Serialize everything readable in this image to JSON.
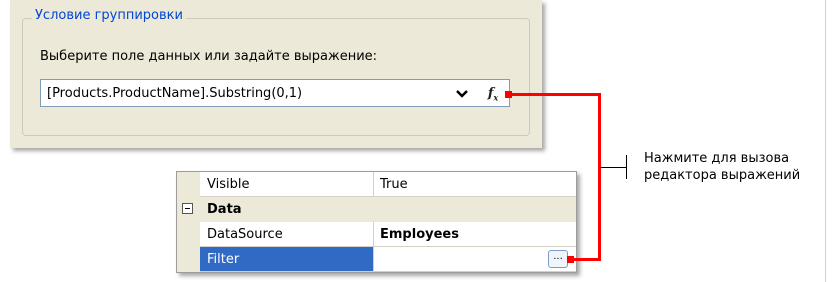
{
  "dialog": {
    "group_title": "Условие группировки",
    "prompt": "Выберите поле данных или задайте выражение:",
    "expression_value": "[Products.ProductName].Substring(0,1)",
    "dropdown_icon": "chevron-down-icon",
    "fx_button": {
      "label": "f",
      "sub": "x"
    }
  },
  "property_grid": {
    "rows": [
      {
        "name": "Visible",
        "value": "True"
      },
      {
        "category": "Data",
        "expanded": true
      },
      {
        "name": "DataSource",
        "value": "Employees"
      },
      {
        "name": "Filter",
        "value": "",
        "selected": true,
        "button_label": "..."
      }
    ]
  },
  "callout": {
    "line1": "Нажмите для вызова",
    "line2": "редактора выражений",
    "color": "#ff0000"
  },
  "colors": {
    "panel_bg": "#ece9d8",
    "legend_blue": "#0046d5",
    "selection": "#316ac5"
  }
}
